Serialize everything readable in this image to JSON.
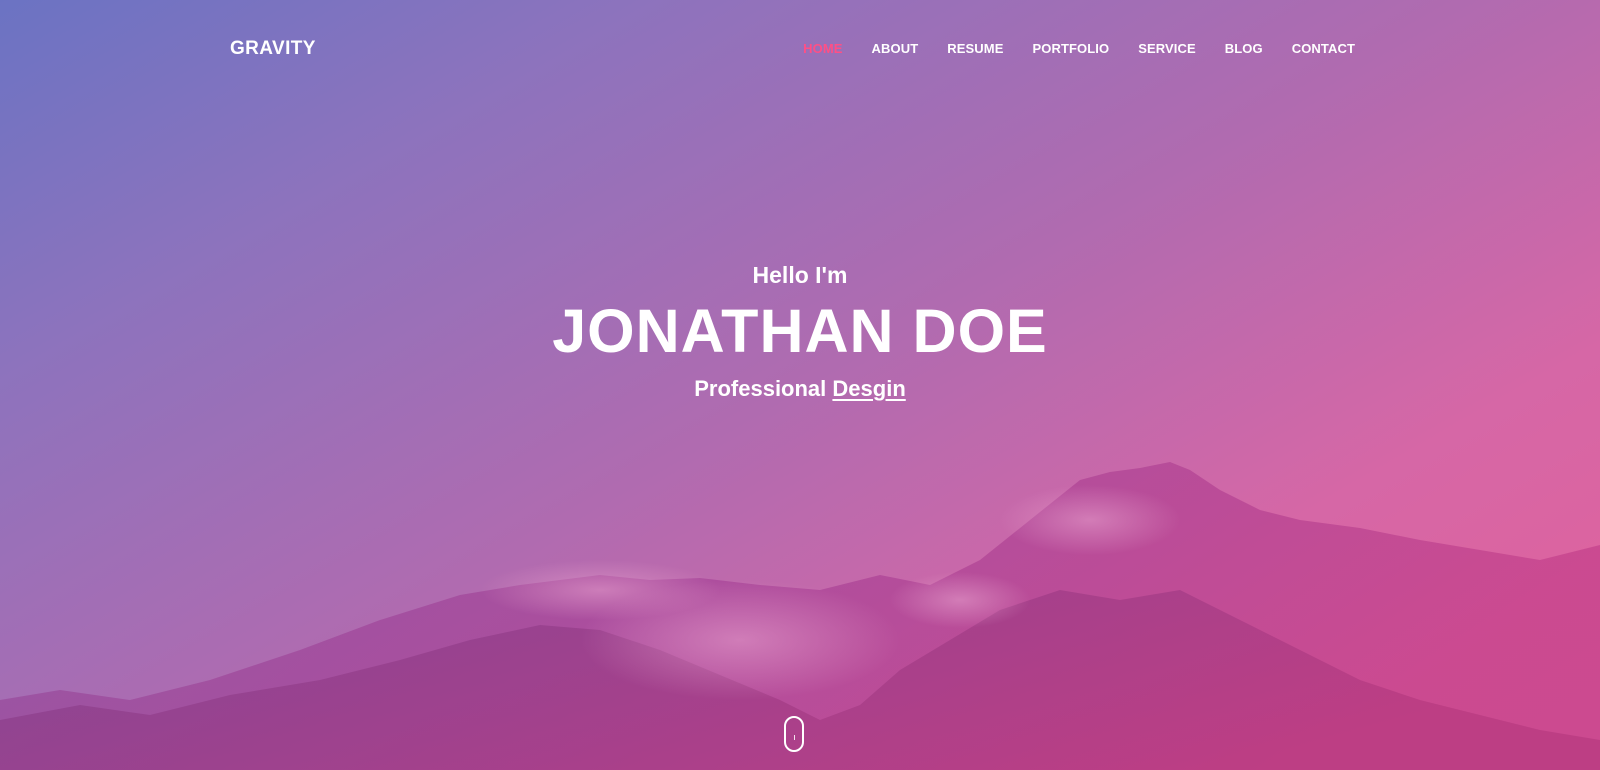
{
  "brand": "GRAVITY",
  "nav": {
    "items": [
      {
        "label": "HOME",
        "active": true
      },
      {
        "label": "ABOUT",
        "active": false
      },
      {
        "label": "RESUME",
        "active": false
      },
      {
        "label": "PORTFOLIO",
        "active": false
      },
      {
        "label": "SERVICE",
        "active": false
      },
      {
        "label": "BLOG",
        "active": false
      },
      {
        "label": "CONTACT",
        "active": false
      }
    ]
  },
  "hero": {
    "greeting": "Hello I'm",
    "name": "JONATHAN DOE",
    "tagline_prefix": "Professional",
    "tagline_highlight": "Desgin"
  },
  "colors": {
    "accent": "#ff4f86",
    "gradient_start": "#6b73c3",
    "gradient_end": "#e2609a"
  },
  "icons": {
    "scroll": "mouse-scroll-icon"
  }
}
